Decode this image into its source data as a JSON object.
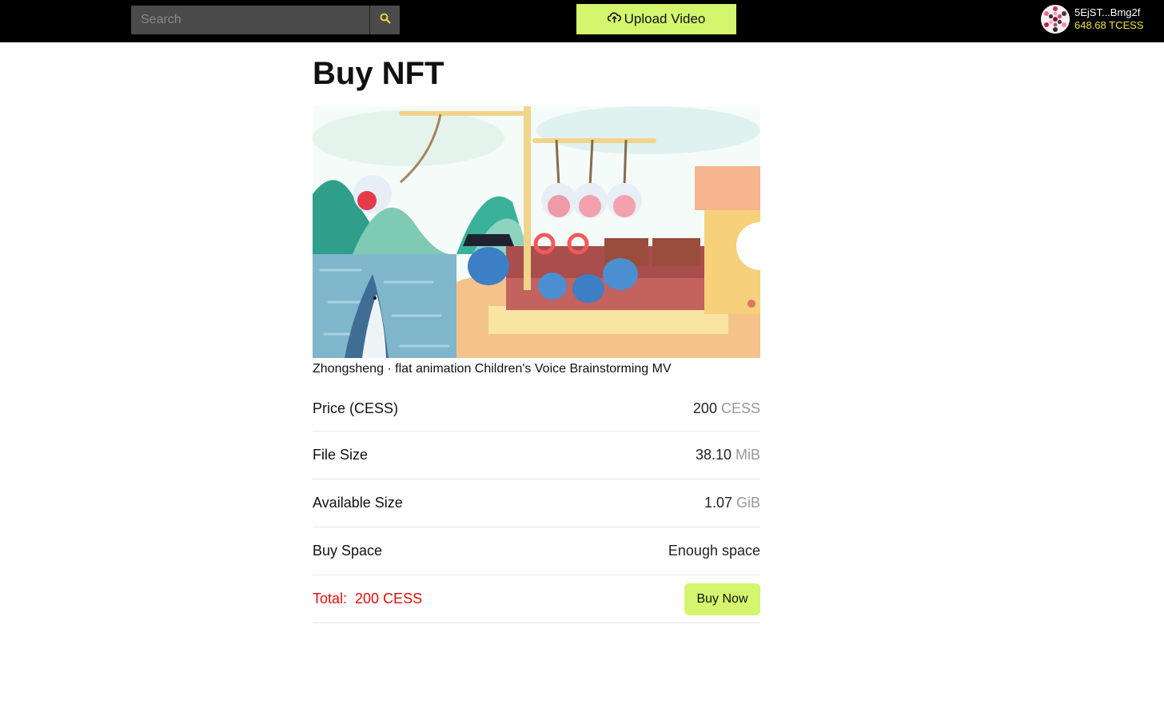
{
  "search": {
    "placeholder": "Search"
  },
  "header": {
    "upload_label": "Upload Video",
    "account_address": "5EjST...Bmg2f",
    "account_balance": "648.68 TCESS"
  },
  "page": {
    "title": "Buy NFT",
    "video_title": "Zhongsheng · flat animation Children's Voice Brainstorming MV"
  },
  "details": {
    "price_label": "Price (CESS)",
    "price_value": "200",
    "price_unit": "CESS",
    "filesize_label": "File Size",
    "filesize_value": "38.10",
    "filesize_unit": "MiB",
    "available_label": "Available Size",
    "available_value": "1.07",
    "available_unit": "GiB",
    "buyspace_label": "Buy Space",
    "buyspace_value": "Enough space",
    "total_text": "Total:  200 CESS",
    "buy_label": "Buy Now"
  },
  "colors": {
    "accent": "#d4f56e",
    "topbar": "#000000",
    "balance": "#f2e43a",
    "ok": "#2e8b26",
    "total": "#e10c0c"
  }
}
